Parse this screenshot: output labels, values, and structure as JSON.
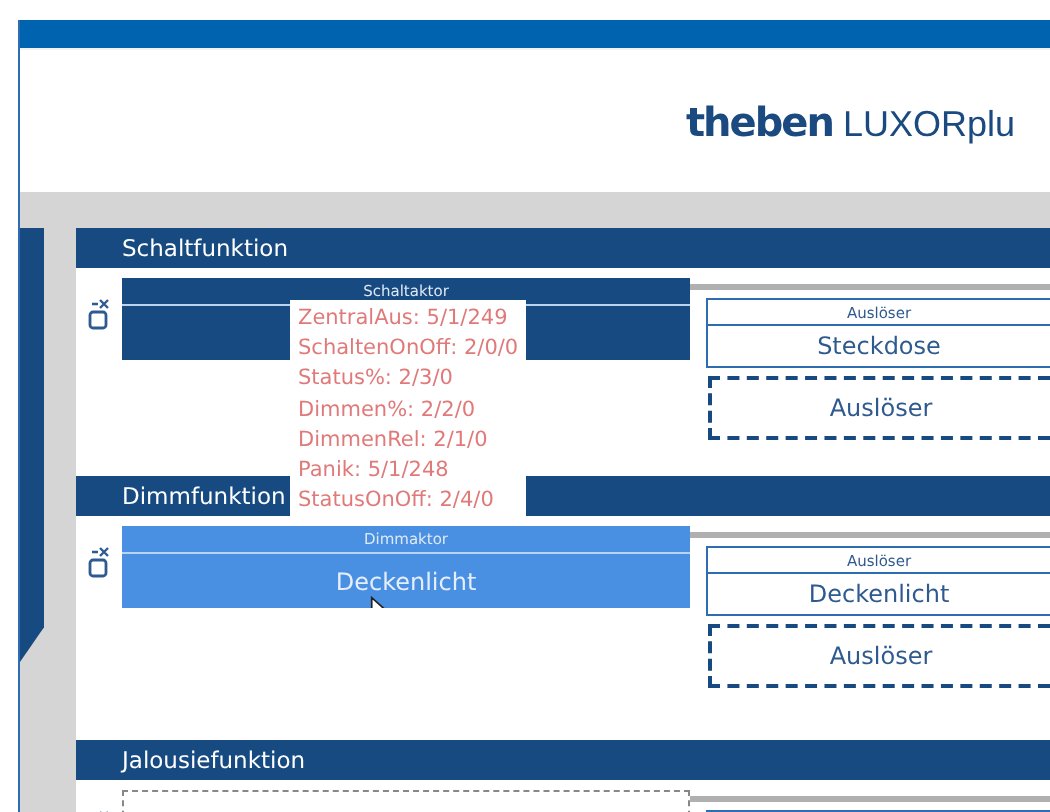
{
  "header": {
    "brand": "theben",
    "product": "LUXORplu"
  },
  "sections": [
    {
      "title": "Schaltfunktion",
      "actor": {
        "kind": "assigned",
        "type_label": "Schaltaktor",
        "selected": false
      },
      "triggers": [
        {
          "kind": "assigned",
          "type_label": "Auslöser",
          "name": "Steckdose"
        },
        {
          "kind": "placeholder",
          "label": "Auslöser"
        }
      ]
    },
    {
      "title": "Dimmfunktion",
      "actor": {
        "kind": "assigned",
        "type_label": "Dimmaktor",
        "name": "Deckenlicht",
        "selected": true
      },
      "triggers": [
        {
          "kind": "assigned",
          "type_label": "Auslöser",
          "name": "Deckenlicht"
        },
        {
          "kind": "placeholder",
          "label": "Auslöser"
        }
      ]
    },
    {
      "title": "Jalousiefunktion",
      "actor": {
        "kind": "empty"
      },
      "triggers": [
        {
          "kind": "assigned"
        }
      ]
    }
  ],
  "tooltip": {
    "lines": [
      "ZentralAus: 5/1/249",
      "SchaltenOnOff: 2/0/0",
      "Status%: 2/3/0",
      "Dimmen%: 2/2/0",
      "DimmenRel: 2/1/0",
      "Panik: 5/1/248",
      "StatusOnOff: 2/4/0"
    ]
  }
}
